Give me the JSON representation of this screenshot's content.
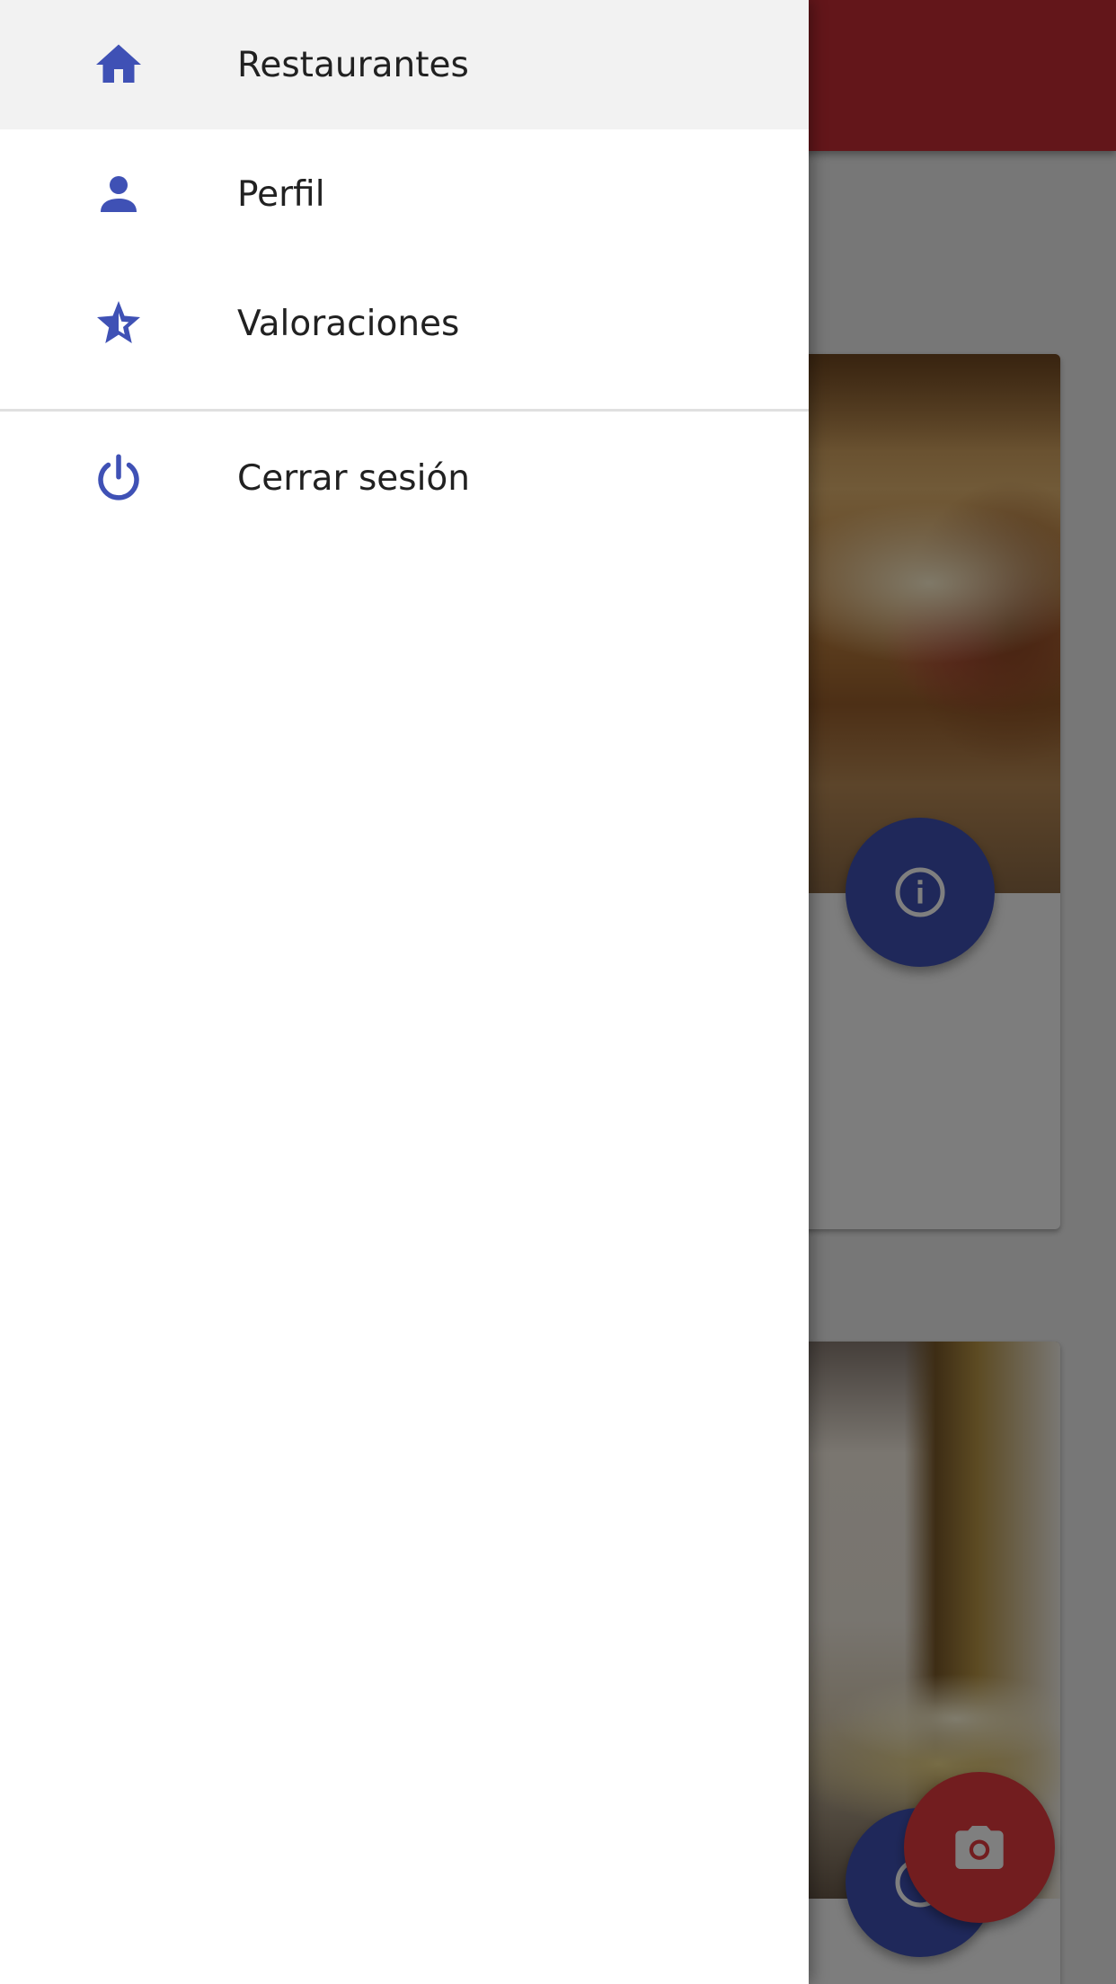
{
  "colors": {
    "accent_blue": "#3f51b5",
    "appbar_red": "#c62d34",
    "camera_fab_red": "#e53a3f",
    "drawer_background": "#ffffff",
    "active_item_background": "#f2f2f2",
    "label_color": "#212121"
  },
  "drawer": {
    "items": [
      {
        "label": "Restaurantes",
        "icon": "home-icon",
        "active": true
      },
      {
        "label": "Perfil",
        "icon": "person-icon",
        "active": false
      },
      {
        "label": "Valoraciones",
        "icon": "star-outline-icon",
        "active": false
      }
    ],
    "logout": {
      "label": "Cerrar sesión",
      "icon": "power-icon"
    }
  },
  "background": {
    "cards": [
      {
        "image": "restaurant-interior-photo",
        "fab_icon": "info-icon"
      },
      {
        "image": "restaurant-dining-room-photo",
        "fab_icon": "info-icon"
      }
    ],
    "camera_fab_icon": "camera-icon"
  }
}
